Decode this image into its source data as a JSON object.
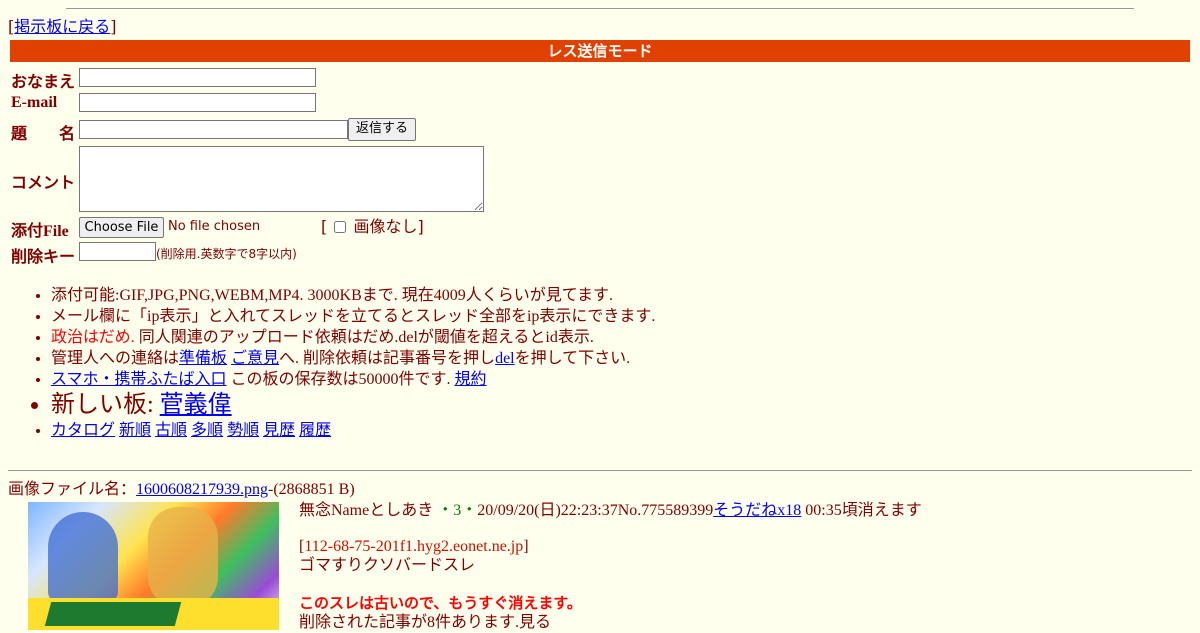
{
  "nav": {
    "open_bracket": "[",
    "back_link": "掲示板に戻る",
    "close_bracket": "]"
  },
  "mode_title": "レス送信モード",
  "form": {
    "name_label": "おなまえ",
    "email_label": "E-mail",
    "subject_label": "題　　名",
    "reply_button": "返信する",
    "comment_label": "コメント",
    "file_label": "添付File",
    "choose_file_button": "Choose File",
    "no_file_text": "No file chosen",
    "no_image_open": "[",
    "no_image_label": "画像なし",
    "no_image_close": "]",
    "delkey_label": "削除キー",
    "delkey_note": "(削除用.英数字で8字以内)"
  },
  "rules": {
    "r1": "添付可能:GIF,JPG,PNG,WEBM,MP4. 3000KBまで. 現在4009人くらいが見てます.",
    "r2": "メール欄に「ip表示」と入れてスレッドを立てるとスレッド全部をip表示にできます.",
    "r3_red": "政治はだめ.",
    "r3_rest": " 同人関連のアップロード依頼はだめ.delが閾値を超えるとid表示.",
    "r4_pre": "管理人への連絡は",
    "r4_link1": "準備板",
    "r4_link2": "ご意見",
    "r4_mid": "へ. 削除依頼は記事番号を押し",
    "r4_link3": "del",
    "r4_post": "を押して下さい.",
    "r5_link": "スマホ・携帯ふたば入口",
    "r5_mid": " この板の保存数は50000件です. ",
    "r5_link2": "規約",
    "r6_text": "新しい板: ",
    "r6_link": "菅義偉",
    "r7_links": [
      "カタログ",
      "新順",
      "古順",
      "多順",
      "勢順",
      "見歴",
      "履歴"
    ]
  },
  "post": {
    "file_label": "画像ファイル名：",
    "file_name": "1600608217939.png",
    "file_size": "-(2868851 B)",
    "subject_name": "無念Nameとしあき",
    "dot1": "・",
    "count": "3",
    "dot2": "・",
    "datetime_no": "20/09/20(日)22:23:37No.775589399",
    "soudane": "そうだねx18",
    "expire": " 00:35頃消えます",
    "ip_open": "[",
    "ip": "112-68-75-201f1.hyg2.eonet.ne.jp",
    "ip_close": "]",
    "body": "ゴマすりクソバードスレ",
    "old_warning": "このスレは古いので、もうすぐ消えます。",
    "deleted_note": "削除された記事が8件あります.見る"
  },
  "colors": {
    "accent": "#e04000",
    "background": "#ffffee",
    "text": "#800000",
    "link": "#0000ee"
  }
}
